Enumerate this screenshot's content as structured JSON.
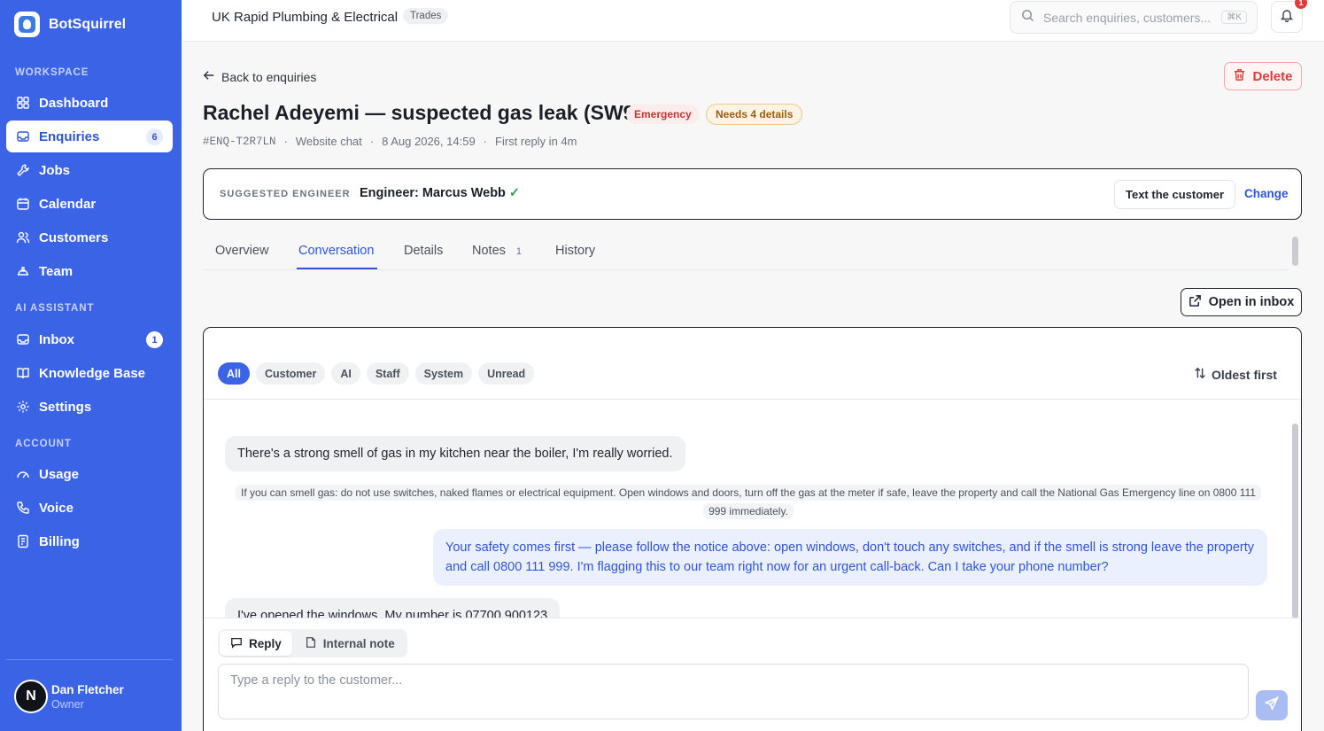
{
  "brand": {
    "name": "BotSquirrel"
  },
  "sidebar": {
    "sections": {
      "workspace": "WORKSPACE",
      "ai_assistant": "AI ASSISTANT",
      "account": "ACCOUNT"
    },
    "items": [
      {
        "label": "Dashboard",
        "icon": "grid-icon"
      },
      {
        "label": "Enquiries",
        "icon": "inbox-icon",
        "badge": "6",
        "active": true
      },
      {
        "label": "Jobs",
        "icon": "wrench-icon"
      },
      {
        "label": "Calendar",
        "icon": "calendar-icon"
      },
      {
        "label": "Customers",
        "icon": "users-icon"
      },
      {
        "label": "Team",
        "icon": "hardhat-icon"
      },
      {
        "label": "Inbox",
        "icon": "mail-icon",
        "badge": "1"
      },
      {
        "label": "Knowledge Base",
        "icon": "book-icon"
      },
      {
        "label": "Settings",
        "icon": "gear-icon"
      },
      {
        "label": "Usage",
        "icon": "gauge-icon"
      },
      {
        "label": "Voice",
        "icon": "phone-icon"
      },
      {
        "label": "Billing",
        "icon": "receipt-icon"
      }
    ],
    "user": {
      "initial": "N",
      "name": "Dan Fletcher",
      "role": "Owner"
    }
  },
  "topbar": {
    "company": "UK Rapid Plumbing & Electrical",
    "badge": "Trades",
    "search_placeholder": "Search enquiries, customers...",
    "shortcut": "⌘K",
    "notifications": "1"
  },
  "enquiry": {
    "back_label": "Back to enquiries",
    "delete_label": "Delete",
    "title": "Rachel Adeyemi — suspected gas leak (SW9)",
    "priority": "Emergency",
    "needs": "Needs 4 details",
    "meta": {
      "id": "#ENQ-T2R7LN",
      "channel": "Website chat",
      "date": "8 Aug 2026, 14:59",
      "first_reply": "First reply in 4m"
    },
    "engineer": {
      "label": "SUGGESTED ENGINEER",
      "name": "Engineer: Marcus Webb",
      "check": "✓",
      "text_btn": "Text the customer",
      "change": "Change"
    }
  },
  "tabs": [
    {
      "label": "Overview"
    },
    {
      "label": "Conversation",
      "active": true
    },
    {
      "label": "Details"
    },
    {
      "label": "Notes",
      "count": "1"
    },
    {
      "label": "History"
    }
  ],
  "open_inbox_label": "Open in inbox",
  "conversation": {
    "filters": [
      "All",
      "Customer",
      "AI",
      "Staff",
      "System",
      "Unread"
    ],
    "active_filter": "All",
    "sort_label": "Oldest first",
    "messages": [
      {
        "role": "customer",
        "text": "There's a strong smell of gas in my kitchen near the boiler, I'm really worried."
      },
      {
        "role": "system",
        "text": "If you can smell gas: do not use switches, naked flames or electrical equipment. Open windows and doors, turn off the gas at the meter if safe, leave the property and call the National Gas Emergency line on 0800 111 999 immediately."
      },
      {
        "role": "ai",
        "text": "Your safety comes first — please follow the notice above: open windows, don't touch any switches, and if the smell is strong leave the property and call 0800 111 999. I'm flagging this to our team right now for an urgent call-back. Can I take your phone number?"
      },
      {
        "role": "customer",
        "text": "I've opened the windows. My number is 07700 900123"
      }
    ],
    "composer": {
      "reply_tab": "Reply",
      "note_tab": "Internal note",
      "placeholder": "Type a reply to the customer..."
    }
  },
  "colors": {
    "brand": "#3b63e6",
    "emergency": "#c73434",
    "needs": "#9a5d10",
    "ai_text": "#2f55d4"
  }
}
